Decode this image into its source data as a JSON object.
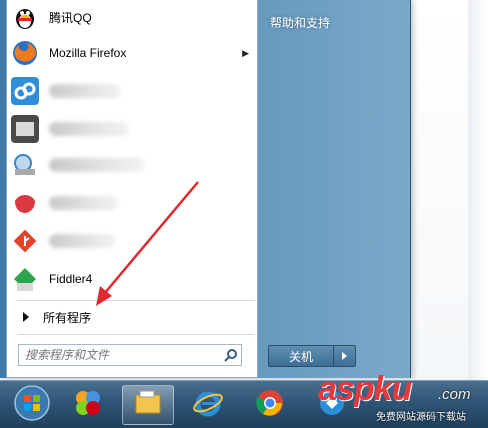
{
  "start_menu": {
    "programs": [
      {
        "label": "腾讯QQ",
        "icon": "qq-penguin-icon",
        "blurred": false,
        "submenu": false
      },
      {
        "label": "Mozilla Firefox",
        "icon": "firefox-icon",
        "blurred": false,
        "submenu": true
      },
      {
        "label": "",
        "icon": "blue-app-icon",
        "blurred": true,
        "submenu": false
      },
      {
        "label": "",
        "icon": "window-app-icon",
        "blurred": true,
        "submenu": false
      },
      {
        "label": "",
        "icon": "globe-app-icon",
        "blurred": true,
        "submenu": false
      },
      {
        "label": "",
        "icon": "red-app-icon",
        "blurred": true,
        "submenu": false
      },
      {
        "label": "",
        "icon": "git-icon",
        "blurred": true,
        "submenu": false
      },
      {
        "label": "Fiddler4",
        "icon": "fiddler-icon",
        "blurred": false,
        "submenu": false
      }
    ],
    "all_programs_label": "所有程序",
    "search_placeholder": "搜索程序和文件",
    "right_items": [
      "帮助和支持"
    ],
    "shutdown_label": "关机"
  },
  "taskbar": {
    "items": [
      {
        "name": "start-orb",
        "icon": "windows-logo-icon",
        "active": false
      },
      {
        "name": "app-2",
        "icon": "colorful-app-icon",
        "active": false
      },
      {
        "name": "explorer",
        "icon": "folder-icon",
        "active": true
      },
      {
        "name": "ie",
        "icon": "internet-explorer-icon",
        "active": false
      },
      {
        "name": "chrome",
        "icon": "chrome-icon",
        "active": false
      },
      {
        "name": "app-6",
        "icon": "blue-round-icon",
        "active": false
      }
    ]
  },
  "watermark": {
    "brand": "aspku",
    "domain": ".com",
    "tagline": "免费网站源码下载站"
  },
  "annotation_color": "#e0282f"
}
